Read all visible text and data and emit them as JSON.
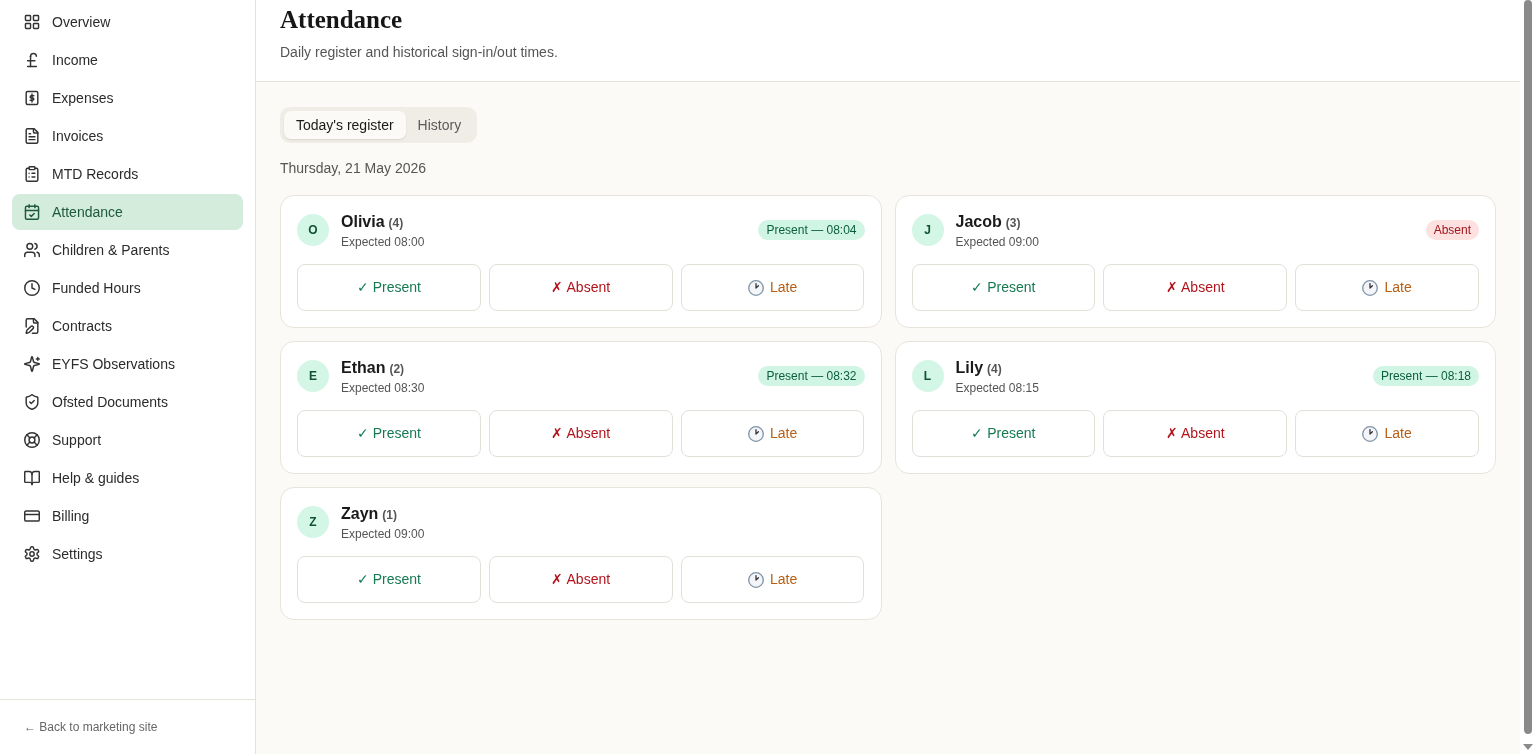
{
  "sidebar": {
    "items": [
      {
        "label": "Overview",
        "selected": false
      },
      {
        "label": "Income",
        "selected": false
      },
      {
        "label": "Expenses",
        "selected": false
      },
      {
        "label": "Invoices",
        "selected": false
      },
      {
        "label": "MTD Records",
        "selected": false
      },
      {
        "label": "Attendance",
        "selected": true
      },
      {
        "label": "Children & Parents",
        "selected": false
      },
      {
        "label": "Funded Hours",
        "selected": false
      },
      {
        "label": "Contracts",
        "selected": false
      },
      {
        "label": "EYFS Observations",
        "selected": false
      },
      {
        "label": "Ofsted Documents",
        "selected": false
      },
      {
        "label": "Support",
        "selected": false
      },
      {
        "label": "Help & guides",
        "selected": false
      },
      {
        "label": "Billing",
        "selected": false
      },
      {
        "label": "Settings",
        "selected": false
      }
    ],
    "footer_link": "← Back to marketing site"
  },
  "header": {
    "title": "Attendance",
    "subtitle": "Daily register and historical sign-in/out times."
  },
  "tabs": [
    {
      "label": "Today's register",
      "selected": true
    },
    {
      "label": "History",
      "selected": false
    }
  ],
  "date": "Thursday, 21 May 2026",
  "register": [
    {
      "initial": "O",
      "name": "Olivia",
      "age": "(4)",
      "expected": "Expected 08:00",
      "status": {
        "kind": "present",
        "label": "Present — 08:04"
      },
      "actions": [
        {
          "kind": "present",
          "label": "✓ Present"
        },
        {
          "kind": "absent",
          "label": "✗ Absent"
        },
        {
          "kind": "late",
          "label": "Late"
        }
      ]
    },
    {
      "initial": "J",
      "name": "Jacob",
      "age": "(3)",
      "expected": "Expected 09:00",
      "status": {
        "kind": "absent",
        "label": "Absent"
      },
      "actions": [
        {
          "kind": "present",
          "label": "✓ Present"
        },
        {
          "kind": "absent",
          "label": "✗ Absent"
        },
        {
          "kind": "late",
          "label": "Late"
        }
      ]
    },
    {
      "initial": "E",
      "name": "Ethan",
      "age": "(2)",
      "expected": "Expected 08:30",
      "status": {
        "kind": "present",
        "label": "Present — 08:32"
      },
      "actions": [
        {
          "kind": "present",
          "label": "✓ Present"
        },
        {
          "kind": "absent",
          "label": "✗ Absent"
        },
        {
          "kind": "late",
          "label": "Late"
        }
      ]
    },
    {
      "initial": "L",
      "name": "Lily",
      "age": "(4)",
      "expected": "Expected 08:15",
      "status": {
        "kind": "present",
        "label": "Present — 08:18"
      },
      "actions": [
        {
          "kind": "present",
          "label": "✓ Present"
        },
        {
          "kind": "absent",
          "label": "✗ Absent"
        },
        {
          "kind": "late",
          "label": "Late"
        }
      ]
    },
    {
      "initial": "Z",
      "name": "Zayn",
      "age": "(1)",
      "expected": "Expected 09:00",
      "actions": [
        {
          "kind": "present",
          "label": "✓ Present"
        },
        {
          "kind": "absent",
          "label": "✗ Absent"
        },
        {
          "kind": "late",
          "label": "Late"
        }
      ]
    }
  ]
}
